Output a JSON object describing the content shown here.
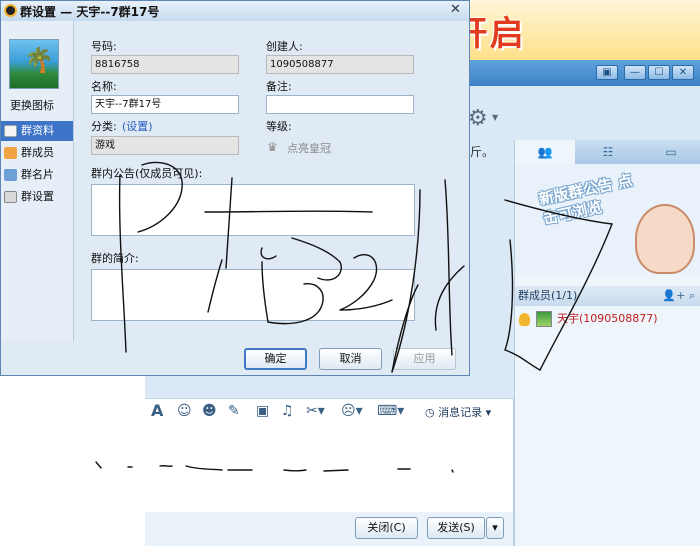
{
  "dialog": {
    "title": "群设置 — 天宇--7群17号",
    "close_glyph": "✕",
    "change_icon": "更换图标",
    "nav": [
      {
        "label": "群资料",
        "icon": "group-info-icon",
        "selected": true
      },
      {
        "label": "群成员",
        "icon": "group-members-icon",
        "selected": false
      },
      {
        "label": "群名片",
        "icon": "group-card-icon",
        "selected": false
      },
      {
        "label": "群设置",
        "icon": "group-settings-icon",
        "selected": false
      }
    ],
    "fields": {
      "number_label": "号码:",
      "number_value": "8816758",
      "creator_label": "创建人:",
      "creator_value": "1090508877",
      "name_label": "名称:",
      "name_value": "天宇--7群17号",
      "remark_label": "备注:",
      "remark_value": "",
      "category_label": "分类:",
      "category_link": "(设置)",
      "category_value": "游戏",
      "level_label": "等级:",
      "level_value": "点亮皇冠",
      "announcement_label": "群内公告(仅成员可见):",
      "intro_label": "群的简介:"
    },
    "buttons": {
      "ok": "确定",
      "cancel": "取消",
      "apply": "应用"
    }
  },
  "chat": {
    "banner_text": "E! 神战开启",
    "window_controls": [
      "▣",
      "▾",
      "—",
      "☐",
      "✕"
    ],
    "partial_text": "斤。",
    "side_tabs": [
      "",
      "",
      ""
    ],
    "ad_text": "新版群公告 点击可浏览",
    "members_header": "群成员(1/1)",
    "member_name": "天宇(1090508877)",
    "message_record": "消息记录",
    "close_button": "关闭(C)",
    "send_button": "发送(S)",
    "send_dropdown": "▾"
  },
  "colors": {
    "accent_blue": "#3d74c7",
    "banner_red": "#e23a1c",
    "member_red": "#c01d1d",
    "link_blue": "#2a5bc2"
  }
}
